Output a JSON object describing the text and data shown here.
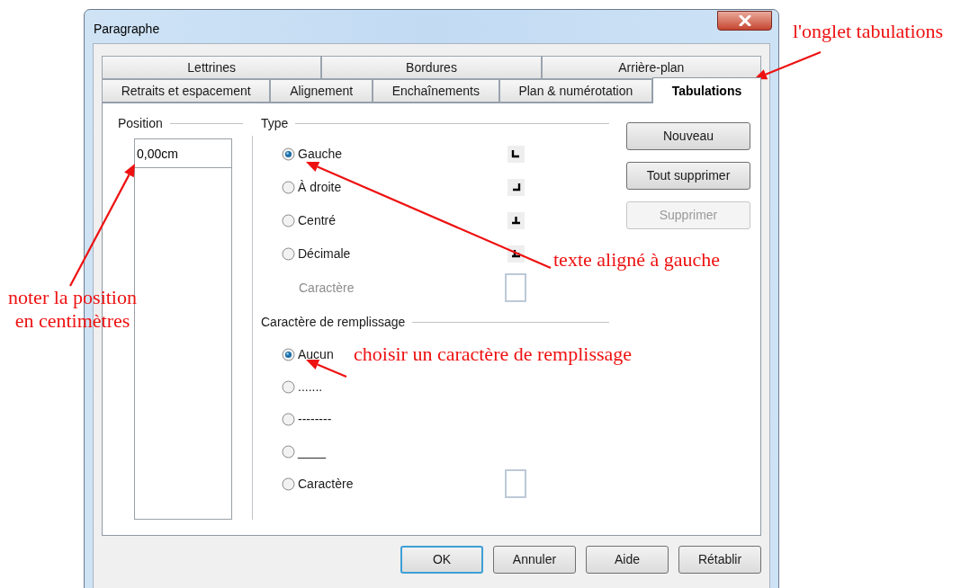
{
  "window": {
    "title": "Paragraphe"
  },
  "tab_rows": [
    [
      {
        "label": "Lettrines",
        "selected": false
      },
      {
        "label": "Bordures",
        "selected": false
      },
      {
        "label": "Arrière-plan",
        "selected": false
      }
    ],
    [
      {
        "label": "Retraits et espacement",
        "selected": false
      },
      {
        "label": "Alignement",
        "selected": false
      },
      {
        "label": "Enchaînements",
        "selected": false
      },
      {
        "label": "Plan & numérotation",
        "selected": false
      },
      {
        "label": "Tabulations",
        "selected": true
      }
    ]
  ],
  "position": {
    "label": "Position",
    "value": "0,00cm"
  },
  "type": {
    "label": "Type",
    "options": [
      {
        "label": "Gauche",
        "selected": true,
        "kind": "left"
      },
      {
        "label": "À droite",
        "selected": false,
        "kind": "right"
      },
      {
        "label": "Centré",
        "selected": false,
        "kind": "center"
      },
      {
        "label": "Décimale",
        "selected": false,
        "kind": "decimal"
      }
    ],
    "character": {
      "label": "Caractère",
      "disabled": true
    }
  },
  "fill": {
    "label": "Caractère de remplissage",
    "options": [
      {
        "label": "Aucun",
        "selected": true,
        "kind": "plain"
      },
      {
        "label": ".......",
        "selected": false,
        "kind": "plain"
      },
      {
        "label": "--------",
        "selected": false,
        "kind": "plain"
      },
      {
        "label": "____",
        "selected": false,
        "kind": "plain"
      },
      {
        "label": "Caractère",
        "selected": false,
        "kind": "character"
      }
    ]
  },
  "side_buttons": [
    {
      "label": "Nouveau",
      "disabled": false
    },
    {
      "label": "Tout supprimer",
      "disabled": false
    },
    {
      "label": "Supprimer",
      "disabled": true
    }
  ],
  "footer_buttons": [
    {
      "label": "OK",
      "default": true
    },
    {
      "label": "Annuler",
      "default": false
    },
    {
      "label": "Aide",
      "default": false
    },
    {
      "label": "Rétablir",
      "default": false
    }
  ],
  "annotations": [
    {
      "text": "l'onglet tabulations"
    },
    {
      "text": "texte aligné à gauche"
    },
    {
      "text": "noter la position\nen centimètres"
    },
    {
      "text": "choisir un caractère de remplissage"
    }
  ]
}
